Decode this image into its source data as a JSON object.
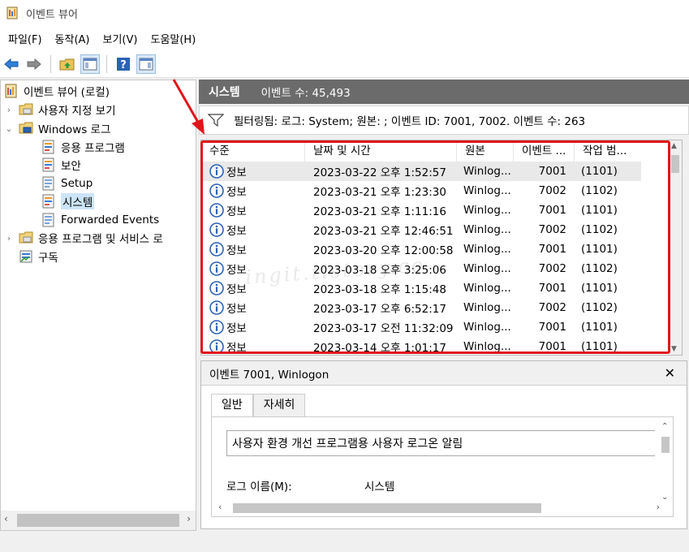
{
  "window": {
    "title": "이벤트 뷰어",
    "app_icon": "event-viewer-icon"
  },
  "menu": [
    "파일(F)",
    "동작(A)",
    "보기(V)",
    "도움말(H)"
  ],
  "toolbar": {
    "icons": [
      "back-icon",
      "forward-icon",
      "up-folder-icon",
      "show-hide-tree-icon",
      "help-icon",
      "action-pane-icon"
    ]
  },
  "tree": {
    "items": [
      {
        "label": "이벤트 뷰어 (로컬)",
        "icon": "event-viewer-icon"
      },
      {
        "label": "사용자 지정 보기",
        "icon": "folder-icon"
      },
      {
        "label": "Windows 로그",
        "icon": "folder-icon"
      },
      {
        "label": "응용 프로그램",
        "icon": "log-icon"
      },
      {
        "label": "보안",
        "icon": "log-icon"
      },
      {
        "label": "Setup",
        "icon": "log-icon"
      },
      {
        "label": "시스템",
        "icon": "log-icon"
      },
      {
        "label": "Forwarded Events",
        "icon": "log-icon"
      },
      {
        "label": "응용 프로그램 및 서비스 로",
        "icon": "folder-icon"
      },
      {
        "label": "구독",
        "icon": "subscription-icon"
      }
    ]
  },
  "header": {
    "title": "시스템",
    "count": "이벤트 수: 45,493"
  },
  "filter": {
    "text": "필터링됨: 로그: System; 원본: ; 이벤트 ID: 7001, 7002. 이벤트 수: 263"
  },
  "columns": [
    "수준",
    "날짜 및 시간",
    "원본",
    "이벤트 ...",
    "작업 범..."
  ],
  "events": [
    {
      "level": "정보",
      "date": "2023-03-22 오후 1:52:57",
      "source": "Winlog...",
      "id": "7001",
      "task": "(1101)"
    },
    {
      "level": "정보",
      "date": "2023-03-21 오후 1:23:30",
      "source": "Winlog...",
      "id": "7002",
      "task": "(1102)"
    },
    {
      "level": "정보",
      "date": "2023-03-21 오후 1:11:16",
      "source": "Winlog...",
      "id": "7001",
      "task": "(1101)"
    },
    {
      "level": "정보",
      "date": "2023-03-21 오후 12:46:51",
      "source": "Winlog...",
      "id": "7002",
      "task": "(1102)"
    },
    {
      "level": "정보",
      "date": "2023-03-20 오후 12:00:58",
      "source": "Winlog...",
      "id": "7001",
      "task": "(1101)"
    },
    {
      "level": "정보",
      "date": "2023-03-18 오후 3:25:06",
      "source": "Winlog...",
      "id": "7002",
      "task": "(1102)"
    },
    {
      "level": "정보",
      "date": "2023-03-18 오후 1:15:48",
      "source": "Winlog...",
      "id": "7001",
      "task": "(1101)"
    },
    {
      "level": "정보",
      "date": "2023-03-17 오후 6:52:17",
      "source": "Winlog...",
      "id": "7002",
      "task": "(1102)"
    },
    {
      "level": "정보",
      "date": "2023-03-17 오전 11:32:09",
      "source": "Winlog...",
      "id": "7001",
      "task": "(1101)"
    },
    {
      "level": "정보",
      "date": "2023-03-14 오후 1:01:17",
      "source": "Winlog...",
      "id": "7001",
      "task": "(1101)"
    }
  ],
  "watermark": "ingit.tistory.co",
  "detail": {
    "title": "이벤트 7001, Winlogon",
    "close": "✕",
    "tabs": [
      "일반",
      "자세히"
    ],
    "description": "사용자 환경 개선 프로그램용 사용자 로그온 알림",
    "log_name_label": "로그 이름(M):",
    "log_name_value": "시스템"
  },
  "colors": {
    "highlight_border": "#e0161b",
    "header_bg": "#6b6b6b",
    "selection": "#e9e9e9"
  }
}
